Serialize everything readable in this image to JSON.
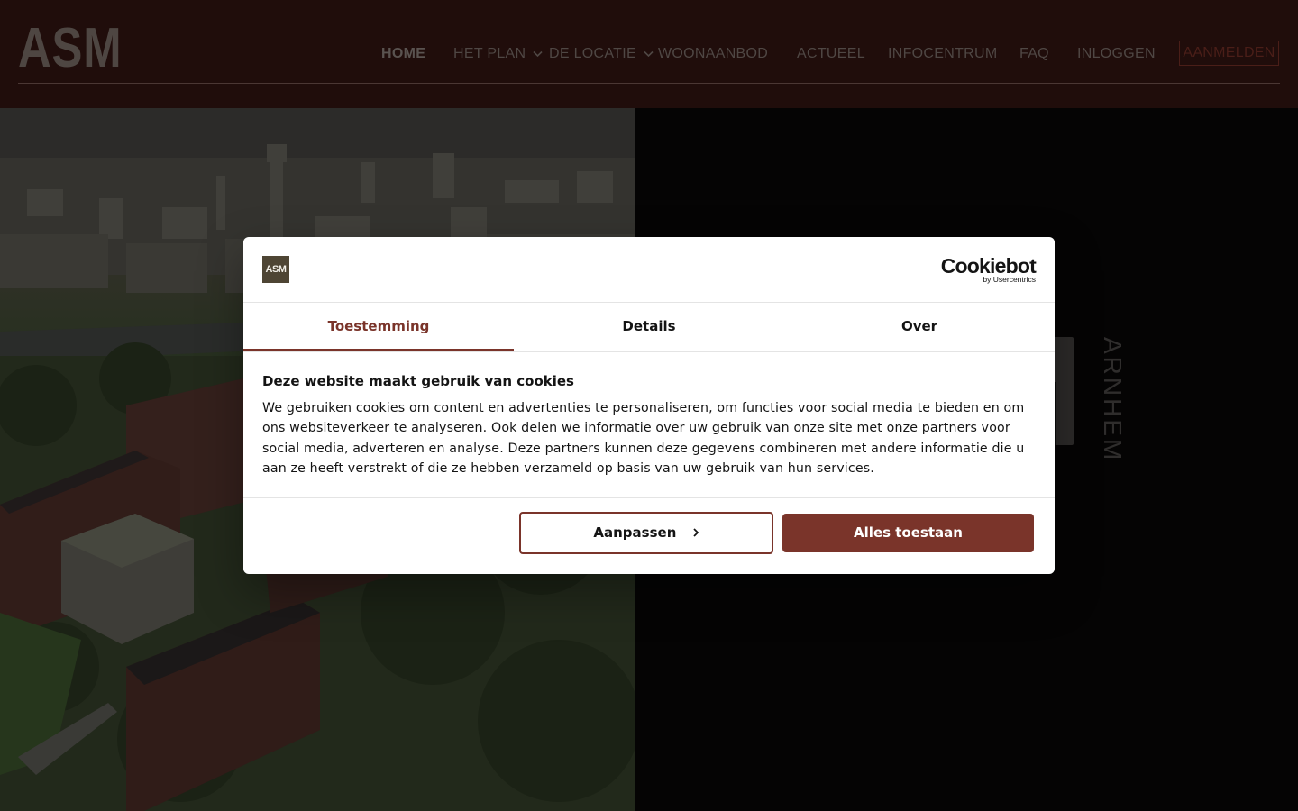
{
  "header": {
    "logo": "ASM",
    "nav": [
      {
        "label": "HOME",
        "active": true,
        "dropdown": false
      },
      {
        "label": "HET PLAN",
        "active": false,
        "dropdown": true
      },
      {
        "label": "DE LOCATIE",
        "active": false,
        "dropdown": true
      },
      {
        "label": "WOONAANBOD",
        "active": false,
        "dropdown": false
      },
      {
        "label": "ACTUEEL",
        "active": false,
        "dropdown": false
      },
      {
        "label": "INFOCENTRUM",
        "active": false,
        "dropdown": false
      },
      {
        "label": "FAQ",
        "active": false,
        "dropdown": false
      },
      {
        "label": "INLOGGEN",
        "active": false,
        "dropdown": false
      }
    ],
    "cta": "AANMELDEN"
  },
  "hero": {
    "city_label": "ARNHEM"
  },
  "cookie_dialog": {
    "brand_logo": "ASM",
    "provider": "Cookiebot",
    "provider_sub": "by Usercentrics",
    "tabs": [
      {
        "label": "Toestemming",
        "active": true
      },
      {
        "label": "Details",
        "active": false
      },
      {
        "label": "Over",
        "active": false
      }
    ],
    "title": "Deze website maakt gebruik van cookies",
    "text": "We gebruiken cookies om content en advertenties te personaliseren, om functies voor social media te bieden en om ons websiteverkeer te analyseren. Ook delen we informatie over uw gebruik van onze site met onze partners voor social media, adverteren en analyse. Deze partners kunnen deze gegevens combineren met andere informatie die u aan ze heeft verstrekt of die ze hebben verzameld op basis van uw gebruik van hun services.",
    "btn_customize": "Aanpassen",
    "btn_allow": "Alles toestaan"
  },
  "colors": {
    "header_bg": "#200d0b",
    "accent": "#7a342a",
    "brand_logo_bg": "#4e4534"
  },
  "icons": {
    "dropdown": "chevron-down-icon",
    "customize_arrow": "chevron-right-icon"
  }
}
